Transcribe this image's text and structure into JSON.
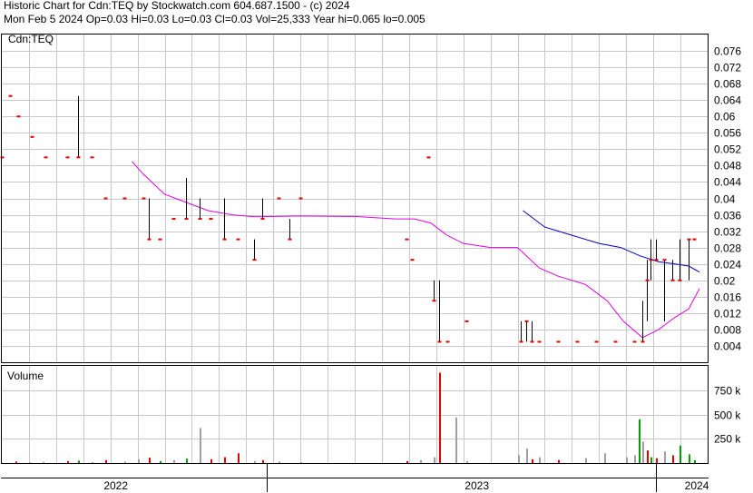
{
  "header": {
    "line1": "Historic Chart for Cdn:TEQ by Stockwatch.com 604.687.1500 - (c) 2024",
    "line2": "Mon Feb  5 2024  Op=0.03  Hi=0.03  Lo=0.03  Cl=0.03  Vol=25,333  Year hi=0.065  lo=0.005"
  },
  "chart_data": [
    {
      "type": "line",
      "title": "Cdn:TEQ",
      "ylim": [
        0,
        0.08
      ],
      "y_ticks": [
        "0.004",
        "0.008",
        "0.012",
        "0.016",
        "0.02",
        "0.024",
        "0.028",
        "0.032",
        "0.036",
        "0.04",
        "0.044",
        "0.048",
        "0.052",
        "0.056",
        "0.06",
        "0.064",
        "0.068",
        "0.072",
        "0.076"
      ],
      "grid": true,
      "colors": {
        "price_high_low": "#000000",
        "price_close": "#e00000",
        "ma_magenta": "#e000e0",
        "ma_blue": "#0000c0",
        "grid": "#c8c8c8"
      },
      "x_labels": [
        "2022",
        "2023",
        "2024"
      ],
      "price_bars": [
        {
          "x": 0.0,
          "h": 0.05,
          "l": 0.05,
          "c": 0.05
        },
        {
          "x": 0.3,
          "h": 0.065,
          "l": 0.065,
          "c": 0.065
        },
        {
          "x": 0.6,
          "h": 0.06,
          "l": 0.06,
          "c": 0.06
        },
        {
          "x": 1.1,
          "h": 0.055,
          "l": 0.055,
          "c": 0.055
        },
        {
          "x": 1.6,
          "h": 0.05,
          "l": 0.05,
          "c": 0.05
        },
        {
          "x": 2.4,
          "h": 0.05,
          "l": 0.05,
          "c": 0.05
        },
        {
          "x": 2.8,
          "h": 0.065,
          "l": 0.05,
          "c": 0.05
        },
        {
          "x": 3.3,
          "h": 0.05,
          "l": 0.05,
          "c": 0.05
        },
        {
          "x": 3.8,
          "h": 0.04,
          "l": 0.04,
          "c": 0.04
        },
        {
          "x": 4.5,
          "h": 0.04,
          "l": 0.04,
          "c": 0.04
        },
        {
          "x": 5.2,
          "h": 0.04,
          "l": 0.04,
          "c": 0.04
        },
        {
          "x": 5.4,
          "h": 0.04,
          "l": 0.03,
          "c": 0.03
        },
        {
          "x": 5.8,
          "h": 0.03,
          "l": 0.03,
          "c": 0.03
        },
        {
          "x": 6.3,
          "h": 0.035,
          "l": 0.035,
          "c": 0.035
        },
        {
          "x": 6.8,
          "h": 0.045,
          "l": 0.035,
          "c": 0.035
        },
        {
          "x": 7.3,
          "h": 0.04,
          "l": 0.035,
          "c": 0.035
        },
        {
          "x": 7.7,
          "h": 0.035,
          "l": 0.035,
          "c": 0.035
        },
        {
          "x": 8.2,
          "h": 0.04,
          "l": 0.03,
          "c": 0.03
        },
        {
          "x": 8.7,
          "h": 0.03,
          "l": 0.03,
          "c": 0.03
        },
        {
          "x": 9.3,
          "h": 0.03,
          "l": 0.025,
          "c": 0.025
        },
        {
          "x": 9.6,
          "h": 0.04,
          "l": 0.035,
          "c": 0.035
        },
        {
          "x": 10.2,
          "h": 0.04,
          "l": 0.04,
          "c": 0.04
        },
        {
          "x": 10.6,
          "h": 0.035,
          "l": 0.03,
          "c": 0.03
        },
        {
          "x": 11.0,
          "h": 0.04,
          "l": 0.04,
          "c": 0.04
        },
        {
          "x": 14.9,
          "h": 0.03,
          "l": 0.03,
          "c": 0.03
        },
        {
          "x": 15.1,
          "h": 0.025,
          "l": 0.025,
          "c": 0.025
        },
        {
          "x": 15.7,
          "h": 0.05,
          "l": 0.05,
          "c": 0.05
        },
        {
          "x": 15.9,
          "h": 0.02,
          "l": 0.015,
          "c": 0.015
        },
        {
          "x": 16.1,
          "h": 0.02,
          "l": 0.005,
          "c": 0.005
        },
        {
          "x": 16.4,
          "h": 0.005,
          "l": 0.005,
          "c": 0.005
        },
        {
          "x": 17.1,
          "h": 0.01,
          "l": 0.01,
          "c": 0.01
        },
        {
          "x": 19.1,
          "h": 0.01,
          "l": 0.005,
          "c": 0.005
        },
        {
          "x": 19.3,
          "h": 0.01,
          "l": 0.005,
          "c": 0.01
        },
        {
          "x": 19.5,
          "h": 0.01,
          "l": 0.005,
          "c": 0.005
        },
        {
          "x": 19.8,
          "h": 0.005,
          "l": 0.005,
          "c": 0.005
        },
        {
          "x": 20.5,
          "h": 0.005,
          "l": 0.005,
          "c": 0.005
        },
        {
          "x": 21.2,
          "h": 0.005,
          "l": 0.005,
          "c": 0.005
        },
        {
          "x": 21.9,
          "h": 0.005,
          "l": 0.005,
          "c": 0.005
        },
        {
          "x": 22.6,
          "h": 0.005,
          "l": 0.005,
          "c": 0.005
        },
        {
          "x": 23.3,
          "h": 0.005,
          "l": 0.005,
          "c": 0.005
        },
        {
          "x": 23.6,
          "h": 0.015,
          "l": 0.005,
          "c": 0.005
        },
        {
          "x": 23.75,
          "h": 0.025,
          "l": 0.01,
          "c": 0.02
        },
        {
          "x": 23.9,
          "h": 0.03,
          "l": 0.02,
          "c": 0.025
        },
        {
          "x": 24.1,
          "h": 0.03,
          "l": 0.025,
          "c": 0.025
        },
        {
          "x": 24.4,
          "h": 0.025,
          "l": 0.01,
          "c": 0.025
        },
        {
          "x": 24.7,
          "h": 0.025,
          "l": 0.02,
          "c": 0.02
        },
        {
          "x": 24.95,
          "h": 0.03,
          "l": 0.02,
          "c": 0.02
        },
        {
          "x": 25.3,
          "h": 0.03,
          "l": 0.02,
          "c": 0.03
        },
        {
          "x": 25.5,
          "h": 0.03,
          "l": 0.03,
          "c": 0.03
        }
      ],
      "ma_magenta": [
        [
          4.8,
          0.049
        ],
        [
          5.2,
          0.046
        ],
        [
          6.0,
          0.041
        ],
        [
          6.8,
          0.039
        ],
        [
          7.6,
          0.037
        ],
        [
          8.5,
          0.036
        ],
        [
          9.3,
          0.0355
        ],
        [
          11.0,
          0.0357
        ],
        [
          13.0,
          0.0356
        ],
        [
          14.5,
          0.035
        ],
        [
          15.2,
          0.035
        ],
        [
          15.8,
          0.034
        ],
        [
          16.4,
          0.031
        ],
        [
          17.0,
          0.029
        ],
        [
          18.0,
          0.028
        ],
        [
          19.0,
          0.028
        ],
        [
          19.8,
          0.023
        ],
        [
          20.5,
          0.021
        ],
        [
          21.5,
          0.019
        ],
        [
          22.3,
          0.015
        ],
        [
          22.9,
          0.01
        ],
        [
          23.6,
          0.006
        ],
        [
          24.2,
          0.008
        ],
        [
          24.8,
          0.011
        ],
        [
          25.3,
          0.013
        ],
        [
          25.7,
          0.018
        ]
      ],
      "ma_blue": [
        [
          19.2,
          0.037
        ],
        [
          20.0,
          0.033
        ],
        [
          21.0,
          0.031
        ],
        [
          22.0,
          0.029
        ],
        [
          22.8,
          0.028
        ],
        [
          23.5,
          0.026
        ],
        [
          24.2,
          0.0245
        ],
        [
          24.8,
          0.024
        ],
        [
          25.3,
          0.0235
        ],
        [
          25.7,
          0.022
        ]
      ]
    },
    {
      "type": "bar",
      "title": "Volume",
      "ylim": [
        0,
        1000000
      ],
      "y_ticks": [
        "250 k",
        "500 k",
        "750 k"
      ],
      "up_color": "#00a000",
      "down_color": "#e00000",
      "flat_color": "#a0a0a0",
      "bars": [
        {
          "x": 0.5,
          "v": 15000,
          "d": "down"
        },
        {
          "x": 1.0,
          "v": 8000,
          "d": "flat"
        },
        {
          "x": 1.5,
          "v": 12000,
          "d": "flat"
        },
        {
          "x": 2.4,
          "v": 20000,
          "d": "down"
        },
        {
          "x": 2.8,
          "v": 25000,
          "d": "up"
        },
        {
          "x": 3.3,
          "v": 10000,
          "d": "flat"
        },
        {
          "x": 3.8,
          "v": 30000,
          "d": "down"
        },
        {
          "x": 4.5,
          "v": 15000,
          "d": "flat"
        },
        {
          "x": 5.0,
          "v": 40000,
          "d": "flat"
        },
        {
          "x": 5.4,
          "v": 55000,
          "d": "down"
        },
        {
          "x": 5.8,
          "v": 20000,
          "d": "up"
        },
        {
          "x": 6.3,
          "v": 30000,
          "d": "flat"
        },
        {
          "x": 6.8,
          "v": 45000,
          "d": "up"
        },
        {
          "x": 7.3,
          "v": 360000,
          "d": "flat"
        },
        {
          "x": 7.7,
          "v": 40000,
          "d": "down"
        },
        {
          "x": 8.2,
          "v": 60000,
          "d": "down"
        },
        {
          "x": 8.7,
          "v": 100000,
          "d": "down"
        },
        {
          "x": 9.3,
          "v": 20000,
          "d": "flat"
        },
        {
          "x": 9.6,
          "v": 30000,
          "d": "down"
        },
        {
          "x": 10.2,
          "v": 15000,
          "d": "flat"
        },
        {
          "x": 11.0,
          "v": 10000,
          "d": "flat"
        },
        {
          "x": 14.9,
          "v": 20000,
          "d": "down"
        },
        {
          "x": 15.4,
          "v": 30000,
          "d": "flat"
        },
        {
          "x": 15.9,
          "v": 60000,
          "d": "flat"
        },
        {
          "x": 16.1,
          "v": 930000,
          "d": "down"
        },
        {
          "x": 16.7,
          "v": 470000,
          "d": "flat"
        },
        {
          "x": 17.1,
          "v": 20000,
          "d": "flat"
        },
        {
          "x": 19.0,
          "v": 80000,
          "d": "flat"
        },
        {
          "x": 19.3,
          "v": 150000,
          "d": "flat"
        },
        {
          "x": 19.5,
          "v": 40000,
          "d": "down"
        },
        {
          "x": 19.8,
          "v": 60000,
          "d": "flat"
        },
        {
          "x": 20.5,
          "v": 30000,
          "d": "down"
        },
        {
          "x": 21.5,
          "v": 50000,
          "d": "flat"
        },
        {
          "x": 22.2,
          "v": 100000,
          "d": "flat"
        },
        {
          "x": 23.0,
          "v": 60000,
          "d": "flat"
        },
        {
          "x": 23.3,
          "v": 80000,
          "d": "flat"
        },
        {
          "x": 23.45,
          "v": 450000,
          "d": "up"
        },
        {
          "x": 23.6,
          "v": 220000,
          "d": "flat"
        },
        {
          "x": 23.75,
          "v": 130000,
          "d": "down"
        },
        {
          "x": 23.9,
          "v": 60000,
          "d": "up"
        },
        {
          "x": 24.1,
          "v": 50000,
          "d": "down"
        },
        {
          "x": 24.4,
          "v": 120000,
          "d": "flat"
        },
        {
          "x": 24.7,
          "v": 80000,
          "d": "down"
        },
        {
          "x": 24.95,
          "v": 180000,
          "d": "up"
        },
        {
          "x": 25.3,
          "v": 90000,
          "d": "up"
        },
        {
          "x": 25.5,
          "v": 30000,
          "d": "up"
        }
      ]
    }
  ]
}
